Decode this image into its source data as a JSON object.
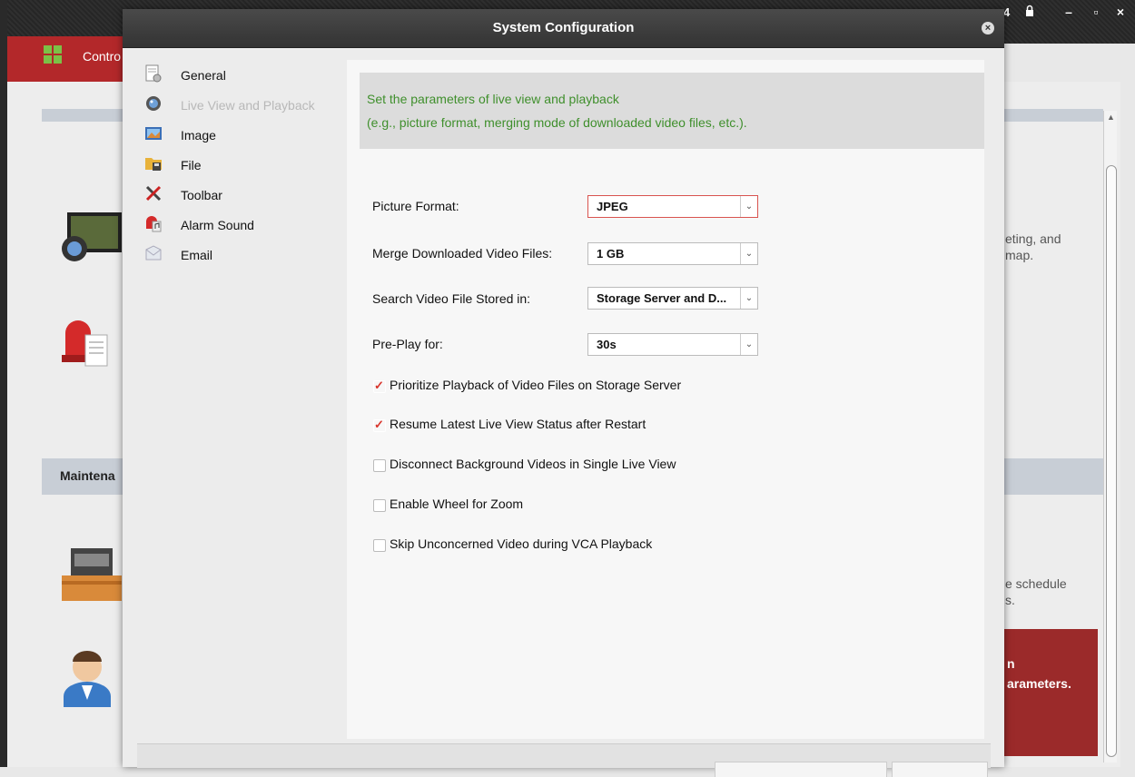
{
  "app": {
    "tab_label": "Contro",
    "maintenance_label": "Maintena",
    "right_text_1": "eting, and",
    "right_text_2": "map.",
    "right_text_3": "e schedule",
    "right_text_4": "s.",
    "right_red_1": "n",
    "right_red_2": "arameters.",
    "titlebar_number": "4",
    "accent_red": "#b3282a"
  },
  "dialog": {
    "title": "System Configuration",
    "close_label": "×",
    "nav": [
      {
        "label": "General",
        "icon": "general-settings-icon",
        "enabled": true
      },
      {
        "label": "Live View and Playback",
        "icon": "camera-lens-icon",
        "enabled": false
      },
      {
        "label": "Image",
        "icon": "image-icon",
        "enabled": true
      },
      {
        "label": "File",
        "icon": "folder-icon",
        "enabled": true
      },
      {
        "label": "Toolbar",
        "icon": "tools-icon",
        "enabled": true
      },
      {
        "label": "Alarm Sound",
        "icon": "alarm-sound-icon",
        "enabled": true
      },
      {
        "label": "Email",
        "icon": "email-icon",
        "enabled": true
      }
    ],
    "info_line1": "Set the parameters of live view and playback",
    "info_line2": "(e.g., picture format, merging mode of downloaded video files, etc.).",
    "fields": {
      "picture_format": {
        "label": "Picture Format:",
        "value": "JPEG"
      },
      "merge_files": {
        "label": "Merge Downloaded Video Files:",
        "value": "1 GB"
      },
      "search_stored": {
        "label": "Search Video File Stored in:",
        "value": "Storage Server and D..."
      },
      "pre_play": {
        "label": "Pre-Play for:",
        "value": "30s"
      }
    },
    "checkboxes": [
      {
        "label": "Prioritize Playback of Video Files on Storage Server",
        "checked": true
      },
      {
        "label": "Resume Latest Live View Status after Restart",
        "checked": true
      },
      {
        "label": "Disconnect Background Videos in Single Live View",
        "checked": false
      },
      {
        "label": "Enable Wheel for Zoom",
        "checked": false
      },
      {
        "label": "Skip Unconcerned Video during VCA Playback",
        "checked": false
      }
    ]
  }
}
